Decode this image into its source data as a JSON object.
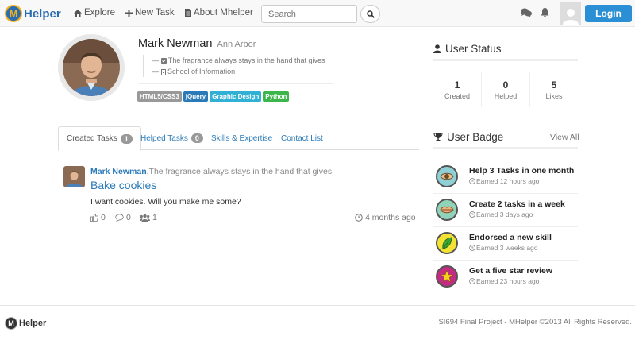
{
  "navbar": {
    "brand": "Helper",
    "brand_logo_letter": "M",
    "links": [
      {
        "label": "Explore",
        "icon": "home-icon"
      },
      {
        "label": "New Task",
        "icon": "plus-icon"
      },
      {
        "label": "About Mhelper",
        "icon": "file-icon"
      }
    ],
    "search_placeholder": "Search",
    "login_label": "Login"
  },
  "profile": {
    "name": "Mark Newman",
    "location": "Ann Arbor",
    "motto": "The fragrance always stays in the hand that gives",
    "affiliation": "School of Information",
    "skills": [
      {
        "label": "HTML5/CSS3",
        "color": "#999999"
      },
      {
        "label": "jQuery",
        "color": "#2a7ab8"
      },
      {
        "label": "Graphic Design",
        "color": "#31b0d5"
      },
      {
        "label": "Python",
        "color": "#3cb54a"
      }
    ]
  },
  "tabs": [
    {
      "label": "Created Tasks",
      "count": "1"
    },
    {
      "label": "Helped Tasks",
      "count": "0"
    },
    {
      "label": "Skills & Expertise"
    },
    {
      "label": "Contact List"
    }
  ],
  "task": {
    "author": "Mark Newman",
    "author_motto": ",The fragrance always stays in the hand that gives",
    "title": "Bake cookies",
    "description": "I want cookies. Will you make me some?",
    "likes": "0",
    "comments": "0",
    "helpers": "1",
    "time": "4 months ago"
  },
  "user_status": {
    "header": "User Status",
    "stats": [
      {
        "value": "1",
        "label": "Created"
      },
      {
        "value": "0",
        "label": "Helped"
      },
      {
        "value": "5",
        "label": "Likes"
      }
    ]
  },
  "user_badge": {
    "header": "User Badge",
    "view_all": "View All",
    "items": [
      {
        "title": "Help 3 Tasks in one month",
        "time": "Earned 12 hours ago",
        "icon": "eye-badge-icon",
        "bg": "#8fd0d6"
      },
      {
        "title": "Create 2 tasks in a week",
        "time": "Earned 3 days ago",
        "icon": "lips-badge-icon",
        "bg": "#8fd3b8"
      },
      {
        "title": "Endorsed a new skill",
        "time": "Earned 3 weeks ago",
        "icon": "leaf-badge-icon",
        "bg": "#f3e234"
      },
      {
        "title": "Get a five star review",
        "time": "Earned 23 hours ago",
        "icon": "star-badge-icon",
        "bg": "#c32b82"
      }
    ]
  },
  "footer": {
    "brand": "Helper",
    "text": "SI694 Final Project - MHelper ©2013 All Rights Reserved."
  }
}
